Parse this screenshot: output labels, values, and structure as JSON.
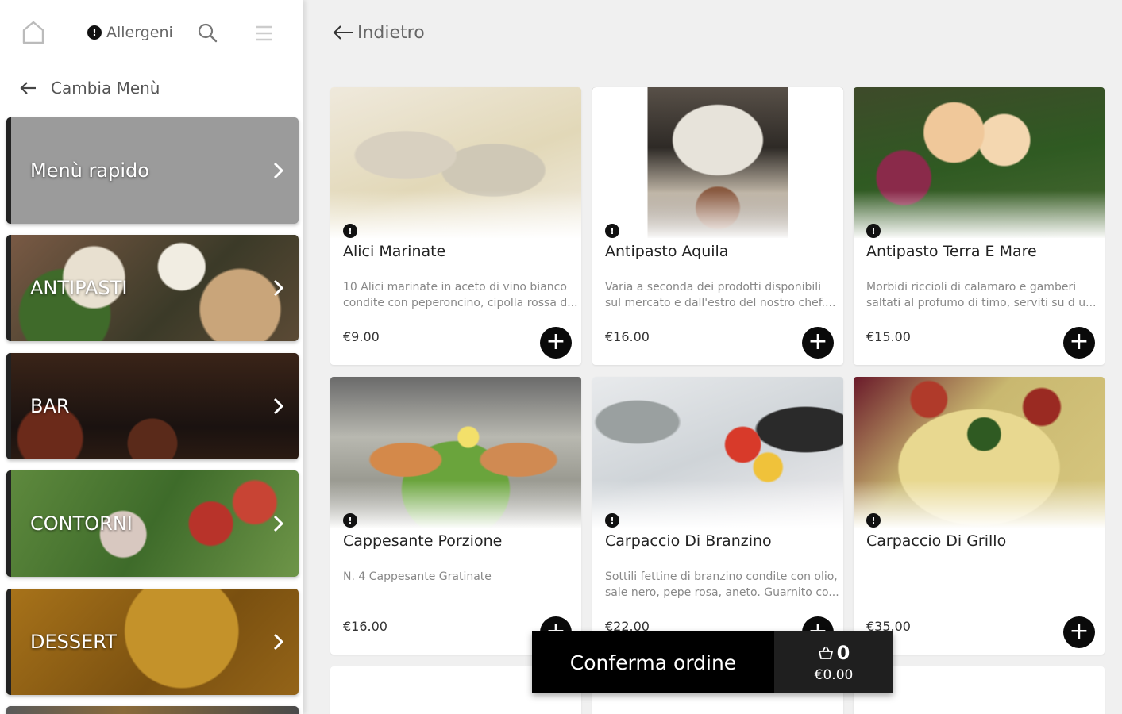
{
  "topbar": {
    "allergens_label": "Allergeni"
  },
  "sidebar": {
    "change_menu_label": "Cambia Menù",
    "categories": [
      {
        "label": "Menù rapido"
      },
      {
        "label": "ANTIPASTI"
      },
      {
        "label": "BAR"
      },
      {
        "label": "CONTORNI"
      },
      {
        "label": "DESSERT"
      }
    ]
  },
  "main": {
    "back_label": "Indietro",
    "products": [
      {
        "name": "Alici Marinate",
        "description": "10 Alici marinate in aceto di vino bianco condite con peperoncino, cipolla rossa d...",
        "price": "€9.00"
      },
      {
        "name": "Antipasto Aquila",
        "description": "Varia a seconda dei prodotti disponibili sul mercato e dall'estro del nostro chef....",
        "price": "€16.00"
      },
      {
        "name": "Antipasto Terra E Mare",
        "description": "Morbidi riccioli di calamaro e gamberi saltati al profumo di timo, serviti su d u...",
        "price": "€15.00"
      },
      {
        "name": "Cappesante Porzione",
        "description": "N. 4 Cappesante Gratinate",
        "price": "€16.00"
      },
      {
        "name": "Carpaccio Di Branzino",
        "description": "Sottili fettine di branzino condite con olio, sale nero, pepe rosa, aneto. Guarnito co...",
        "price": "€22.00"
      },
      {
        "name": "Carpaccio Di Grillo",
        "description": "",
        "price": "€35.00"
      }
    ]
  },
  "order": {
    "confirm_label": "Conferma ordine",
    "count": "0",
    "total": "€0.00"
  },
  "icons": {
    "home": "home-icon",
    "search": "search-icon",
    "menu": "hamburger-icon",
    "info": "info-icon",
    "add": "plus-icon",
    "basket": "basket-icon"
  }
}
